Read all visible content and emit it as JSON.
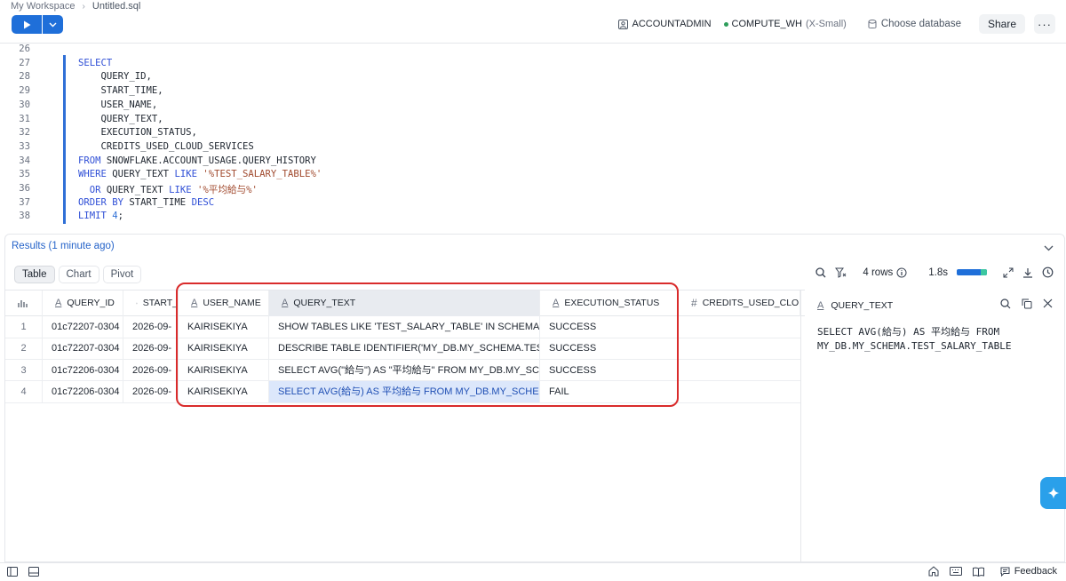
{
  "header": {
    "workspace": "My Workspace",
    "file": "Untitled.sql",
    "role": "ACCOUNTADMIN",
    "warehouse": "COMPUTE_WH",
    "warehouse_size": "(X-Small)",
    "database_placeholder": "Choose database",
    "share_label": "Share",
    "more_label": "···"
  },
  "editor": {
    "line_numbers": [
      "26",
      "27",
      "28",
      "29",
      "30",
      "31",
      "32",
      "33",
      "34",
      "35",
      "36",
      "37",
      "38"
    ],
    "lines": [
      {
        "parts": []
      },
      {
        "parts": [
          {
            "t": "SELECT",
            "c": "kw"
          }
        ]
      },
      {
        "parts": [
          {
            "t": "    QUERY_ID,",
            "c": ""
          }
        ]
      },
      {
        "parts": [
          {
            "t": "    START_TIME,",
            "c": ""
          }
        ]
      },
      {
        "parts": [
          {
            "t": "    USER_NAME,",
            "c": ""
          }
        ]
      },
      {
        "parts": [
          {
            "t": "    QUERY_TEXT,",
            "c": ""
          }
        ]
      },
      {
        "parts": [
          {
            "t": "    EXECUTION_STATUS,",
            "c": ""
          }
        ]
      },
      {
        "parts": [
          {
            "t": "    CREDITS_USED_CLOUD_SERVICES",
            "c": ""
          }
        ]
      },
      {
        "parts": [
          {
            "t": "FROM",
            "c": "kw"
          },
          {
            "t": " SNOWFLAKE.ACCOUNT_USAGE.QUERY_HISTORY",
            "c": ""
          }
        ]
      },
      {
        "parts": [
          {
            "t": "WHERE",
            "c": "kw"
          },
          {
            "t": " QUERY_TEXT ",
            "c": ""
          },
          {
            "t": "LIKE",
            "c": "kw"
          },
          {
            "t": " ",
            "c": ""
          },
          {
            "t": "'%TEST_SALARY_TABLE%'",
            "c": "str"
          }
        ]
      },
      {
        "parts": [
          {
            "t": "  OR",
            "c": "kw"
          },
          {
            "t": " QUERY_TEXT ",
            "c": ""
          },
          {
            "t": "LIKE",
            "c": "kw"
          },
          {
            "t": " ",
            "c": ""
          },
          {
            "t": "'%平均給与%'",
            "c": "str"
          }
        ]
      },
      {
        "parts": [
          {
            "t": "ORDER BY",
            "c": "kw"
          },
          {
            "t": " START_TIME ",
            "c": ""
          },
          {
            "t": "DESC",
            "c": "kw"
          }
        ]
      },
      {
        "parts": [
          {
            "t": "LIMIT",
            "c": "kw"
          },
          {
            "t": " ",
            "c": ""
          },
          {
            "t": "4",
            "c": "num"
          },
          {
            "t": ";",
            "c": ""
          }
        ]
      }
    ]
  },
  "results": {
    "title": "Results (1 minute ago)",
    "tabs": [
      "Table",
      "Chart",
      "Pivot"
    ],
    "active_tab": "Table",
    "rows_label": "4 rows",
    "duration": "1.8s",
    "columns": [
      "QUERY_ID",
      "START_",
      "USER_NAME",
      "QUERY_TEXT",
      "EXECUTION_STATUS",
      "CREDITS_USED_CLOUD_S"
    ],
    "rows": [
      [
        "1",
        "01c72207-0304",
        "2026-09-",
        "KAIRISEKIYA",
        "SHOW TABLES LIKE 'TEST_SALARY_TABLE' IN SCHEMA IDE",
        "SUCCESS"
      ],
      [
        "2",
        "01c72207-0304",
        "2026-09-",
        "KAIRISEKIYA",
        "DESCRIBE TABLE IDENTIFIER('MY_DB.MY_SCHEMA.TEST_S",
        "SUCCESS"
      ],
      [
        "3",
        "01c72206-0304",
        "2026-09-",
        "KAIRISEKIYA",
        "SELECT AVG(\"給与\") AS \"平均給与\" FROM MY_DB.MY_SCHE",
        "SUCCESS"
      ],
      [
        "4",
        "01c72206-0304",
        "2026-09-",
        "KAIRISEKIYA",
        "SELECT AVG(給与) AS 平均給与 FROM MY_DB.MY_SCHEMA",
        "FAIL"
      ]
    ]
  },
  "detail": {
    "column": "QUERY_TEXT",
    "value_line1": "SELECT AVG(給与) AS 平均給与 FROM",
    "value_line2": "MY_DB.MY_SCHEMA.TEST_SALARY_TABLE"
  },
  "footer": {
    "feedback_label": "Feedback"
  },
  "colors": {
    "primary": "#1f6fd9",
    "highlight": "#d92b2b",
    "selected_cell": "#dce7fb"
  }
}
